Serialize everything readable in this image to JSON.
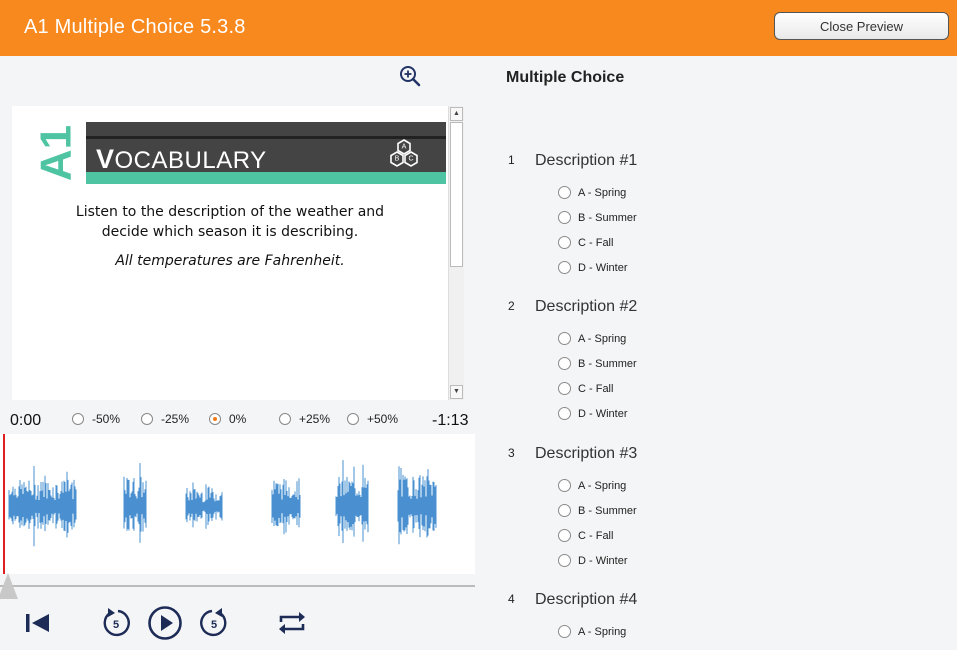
{
  "header": {
    "title": "A1 Multiple Choice 5.3.8",
    "close_label": "Close Preview",
    "bar_color": "#f7891e"
  },
  "slide": {
    "logo_text": "A1",
    "banner_first_letter": "V",
    "banner_rest": "OCABULARY",
    "badge_letters": [
      "A",
      "B",
      "C"
    ],
    "line1": "Listen to the description of the weather and",
    "line2": "decide which season it is describing.",
    "line3": "All temperatures are Fahrenheit.",
    "accent_teal": "#4fc4a3",
    "banner_dark": "#444444"
  },
  "player": {
    "elapsed": "0:00",
    "remaining": "-1:13",
    "rate_options": [
      "-50%",
      "-25%",
      "0%",
      "+25%",
      "+50%"
    ],
    "selected_rate": "0%",
    "progress": 0,
    "wave_color": "#4a90d0",
    "playhead_color": "#e02020",
    "controls": [
      "skip-to-start-icon",
      "rewind-5-icon",
      "play-icon",
      "forward-5-icon",
      "loop-icon"
    ],
    "rewind_seconds": "5",
    "forward_seconds": "5"
  },
  "quiz": {
    "title": "Multiple Choice",
    "questions": [
      {
        "number": "1",
        "title": "Description #1",
        "options": [
          "A - Spring",
          "B - Summer",
          "C - Fall",
          "D - Winter"
        ]
      },
      {
        "number": "2",
        "title": "Description #2",
        "options": [
          "A - Spring",
          "B - Summer",
          "C - Fall",
          "D - Winter"
        ]
      },
      {
        "number": "3",
        "title": "Description #3",
        "options": [
          "A - Spring",
          "B - Summer",
          "C - Fall",
          "D - Winter"
        ]
      },
      {
        "number": "4",
        "title": "Description #4",
        "options": [
          "A - Spring"
        ]
      }
    ]
  }
}
